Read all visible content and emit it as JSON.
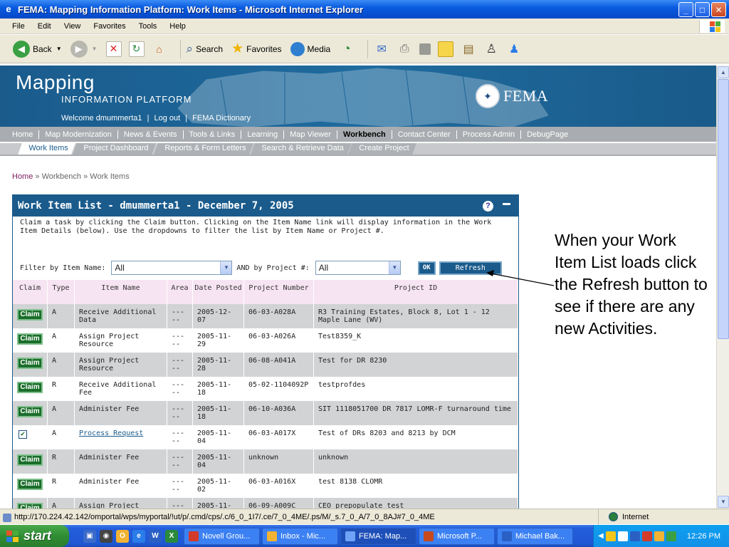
{
  "window": {
    "title": "FEMA: Mapping Information Platform: Work Items - Microsoft Internet Explorer",
    "minimize": "_",
    "maximize": "□",
    "close": "✕"
  },
  "menu": [
    "File",
    "Edit",
    "View",
    "Favorites",
    "Tools",
    "Help"
  ],
  "toolbar": {
    "back": "Back",
    "search": "Search",
    "favorites": "Favorites",
    "media": "Media"
  },
  "banner": {
    "logo_main": "Mapping",
    "logo_sub": "INFORMATION PLATFORM",
    "welcome": "Welcome dmummerta1",
    "logout": "Log out",
    "dictionary": "FEMA Dictionary",
    "sep": "|",
    "agency": "FEMA"
  },
  "nav_primary": [
    {
      "label": "Home",
      "active": false
    },
    {
      "label": "Map Modernization",
      "active": false
    },
    {
      "label": "News & Events",
      "active": false
    },
    {
      "label": "Tools & Links",
      "active": false
    },
    {
      "label": "Learning",
      "active": false
    },
    {
      "label": "Map Viewer",
      "active": false
    },
    {
      "label": "Workbench",
      "active": true
    },
    {
      "label": "Contact Center",
      "active": false
    },
    {
      "label": "Process Admin",
      "active": false
    },
    {
      "label": "DebugPage",
      "active": false
    }
  ],
  "nav_secondary": [
    {
      "label": "Work Items",
      "active": true
    },
    {
      "label": "Project Dashboard",
      "active": false
    },
    {
      "label": "Reports & Form Letters",
      "active": false
    },
    {
      "label": "Search & Retrieve Data",
      "active": false
    },
    {
      "label": "Create Project",
      "active": false
    }
  ],
  "breadcrumb": {
    "home": "Home",
    "sep1": "»",
    "workbench": "Workbench",
    "sep2": "»",
    "current": "Work Items"
  },
  "panel": {
    "title": "Work Item List - dmummerta1 - December 7, 2005",
    "help": "?",
    "description": "Claim a task by clicking the Claim button. Clicking on the Item Name link will display information in the Work Item Details (below). Use the dropdowns to filter the list by Item Name or Project #.",
    "filter_item_label": "Filter by Item Name:",
    "filter_item_value": "All",
    "filter_project_label": "AND by Project #:",
    "filter_project_value": "All",
    "ok_label": "OK",
    "refresh_label": "Refresh"
  },
  "table": {
    "headers": [
      "Claim",
      "Type",
      "Item Name",
      "Area",
      "Date Posted",
      "Project Number",
      "Project ID"
    ],
    "rows": [
      {
        "claim": "Claim",
        "type": "A",
        "item": "Receive Additional Data",
        "area": "-----",
        "date": "2005-12-07",
        "project_number": "06-03-A028A",
        "project_id": "R3 Training Estates, Block 8, Lot 1 - 12 Maple Lane (WV)"
      },
      {
        "claim": "Claim",
        "type": "A",
        "item": "Assign Project Resource",
        "area": "-----",
        "date": "2005-11-29",
        "project_number": "06-03-A026A",
        "project_id": "Test8359_K"
      },
      {
        "claim": "Claim",
        "type": "A",
        "item": "Assign Project Resource",
        "area": "-----",
        "date": "2005-11-28",
        "project_number": "06-08-A041A",
        "project_id": "Test for DR 8230"
      },
      {
        "claim": "Claim",
        "type": "R",
        "item": "Receive Additional Fee",
        "area": "-----",
        "date": "2005-11-18",
        "project_number": "05-02-1104092P",
        "project_id": "testprofdes"
      },
      {
        "claim": "Claim",
        "type": "A",
        "item": "Administer Fee",
        "area": "-----",
        "date": "2005-11-18",
        "project_number": "06-10-A036A",
        "project_id": "SIT 1118051700 DR 7817 LOMR-F turnaround time"
      },
      {
        "claim": "checked",
        "type": "A",
        "item": "Process Request",
        "area": "-----",
        "date": "2005-11-04",
        "project_number": "06-03-A017X",
        "project_id": "Test of DRs 8203 and 8213 by DCM"
      },
      {
        "claim": "Claim",
        "type": "R",
        "item": "Administer Fee",
        "area": "-----",
        "date": "2005-11-04",
        "project_number": "unknown",
        "project_id": "unknown"
      },
      {
        "claim": "Claim",
        "type": "R",
        "item": "Administer Fee",
        "area": "-----",
        "date": "2005-11-02",
        "project_number": "06-03-A016X",
        "project_id": "test 8138 CLOMR"
      },
      {
        "claim": "Claim",
        "type": "A",
        "item": "Assign Project",
        "area": "-----",
        "date": "2005-11-",
        "project_number": "06-09-A009C",
        "project_id": "CEO prepopulate test"
      }
    ]
  },
  "callout": "When your Work Item List loads click the Refresh button to see if there are any new Activities.",
  "statusbar": {
    "url": "http://170.224.42.142/omportal/wps/myportal/!ut/p/.cmd/cps/.c/6_0_1I7/.ce/7_0_4ME/.ps/M/_s.7_0_A/7_0_8AJ#7_0_4ME",
    "zone": "Internet"
  },
  "taskbar": {
    "start": "start",
    "tasks": [
      {
        "label": "Novell Grou...",
        "active": false,
        "color": "#d23a2a"
      },
      {
        "label": "Inbox - Mic...",
        "active": false,
        "color": "#f2b233"
      },
      {
        "label": "FEMA: Map...",
        "active": true,
        "color": "#3f7be8"
      },
      {
        "label": "Microsoft P...",
        "active": false,
        "color": "#c64a1d"
      },
      {
        "label": "Michael Bak...",
        "active": false,
        "color": "#2a5fc4"
      }
    ],
    "clock": "12:26 PM"
  },
  "colors": {
    "brand": "#1a5b8c",
    "claim_green": "#1a6e2a",
    "header_pink": "#f7e4f2",
    "row_gray": "#d1d3d5"
  }
}
